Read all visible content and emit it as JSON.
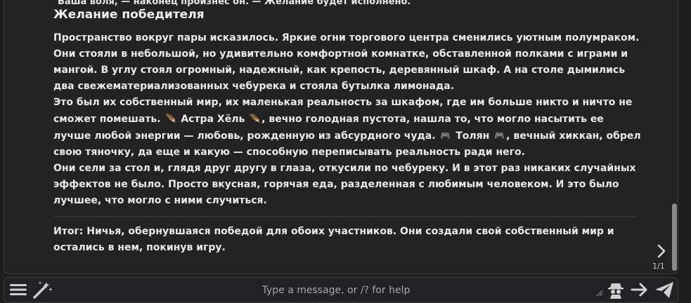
{
  "chat": {
    "cut_text": "Ваша воля, — наконец произнес он. — Желание будет исполнено.",
    "section_title": "Желание победителя",
    "p1": "Пространство вокруг пары исказилось. Яркие огни торгового центра сменились уютным полумраком. Они стояли в небольшой, но удивительно комфортной комнатке, обставленной полками с играми и мангой. В углу стоял огромный, надежный, как крепость, деревянный шкаф. А на столе дымились два свежематериализованных чебурека и стояла бутылка лимонада.",
    "p2_start": "Это был их собственный мир, их маленькая реальность за шкафом, где им больше никто и ничто не сможет помешать.",
    "astra_name": "Астра Хёль",
    "p2_mid": ", вечно голодная пустота, нашла то, что могло насытить ее лучше любой энергии — любовь, рожденную из абсурдного чуда.",
    "tolyan_name": "Толян",
    "p2_end": ", вечный хиккан, обрел свою тяночку, да еще и какую — способную переписывать реальность ради него.",
    "p3": "Они сели за стол и, глядя друг другу в глаза, откусили по чебуреку. И в этот раз никаких случайных эффектов не было. Просто вкусная, горячая еда, разделенная с любимым человеком. И это было лучшее, что могло с ними случиться.",
    "summary": "Итог: Ничья, обернувшаяся победой для обоих участников. Они создали свой собственный мир и остались в нем, покинув игру.",
    "emoji_feather": "🪶",
    "emoji_gamepad": "🎮",
    "swipe_counter": "1/1"
  },
  "input": {
    "placeholder": "Type a message, or /? for help",
    "value": ""
  },
  "icons": {
    "left": [
      "hamburger-menu-icon",
      "magic-wand-icon"
    ],
    "right": [
      "impersonate-icon",
      "continue-arrow-icon",
      "send-icon"
    ]
  },
  "colors": {
    "background": "#1e1e1f",
    "panel": "#232324",
    "text": "#eaeaea",
    "border": "#3a3a3c"
  }
}
